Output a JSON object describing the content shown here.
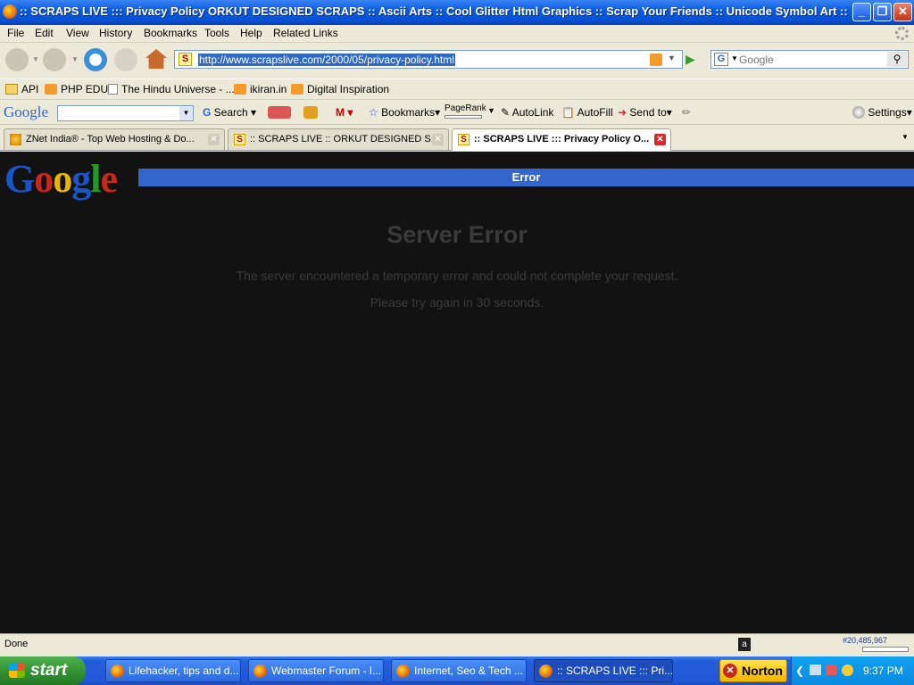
{
  "window": {
    "title": ":: SCRAPS LIVE ::: Privacy Policy ORKUT DESIGNED SCRAPS :: Ascii Arts :: Cool Glitter Html Graphics :: Scrap Your Friends :: Unicode Symbol Art :: -..."
  },
  "menu": [
    "File",
    "Edit",
    "View",
    "History",
    "Bookmarks",
    "Tools",
    "Help",
    "Related Links"
  ],
  "nav": {
    "url": "http://www.scrapslive.com/2000/05/privacy-policy.html",
    "search_placeholder": "Google"
  },
  "bookmarks": [
    "API",
    "PHP EDU",
    "The Hindu Universe - ...",
    "ikiran.in",
    "Digital Inspiration"
  ],
  "google_toolbar": {
    "logo": "Google",
    "search_label": "Search",
    "bookmarks_label": "Bookmarks",
    "pagerank_label": "PageRank",
    "autolink_label": "AutoLink",
    "autofill_label": "AutoFill",
    "sendto_label": "Send to",
    "settings_label": "Settings"
  },
  "tabs": [
    {
      "label": "ZNet India® - Top Web Hosting & Do..."
    },
    {
      "label": ":: SCRAPS LIVE :: ORKUT DESIGNED S..."
    },
    {
      "label": ":: SCRAPS LIVE ::: Privacy Policy O..."
    }
  ],
  "page": {
    "logo": "Google",
    "bar_title": "Error",
    "heading": "Server Error",
    "message1": "The server encountered a temporary error and could not complete your request.",
    "message2": "Please try again in 30 seconds."
  },
  "status": {
    "text": "Done",
    "rank": "#20,485,967"
  },
  "taskbar": {
    "start": "start",
    "items": [
      "Lifehacker, tips and d...",
      "Webmaster Forum - I...",
      "Internet, Seo & Tech ...",
      ":: SCRAPS LIVE ::: Pri..."
    ],
    "norton": "Norton",
    "clock": "9:37 PM"
  },
  "colors": {
    "accent": "#3366cc",
    "content_bg": "#121212",
    "xp_blue": "#245edb"
  }
}
